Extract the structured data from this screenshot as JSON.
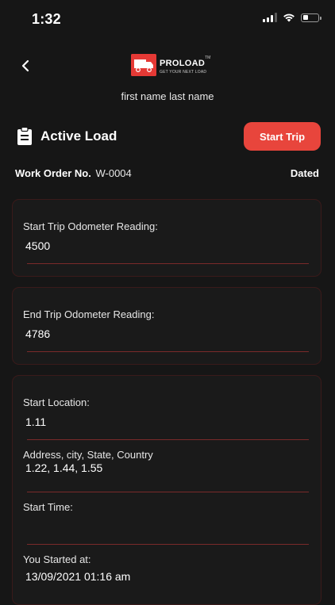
{
  "status": {
    "time": "1:32",
    "battery_level": 0.35
  },
  "header": {
    "logo_name": "PROLOAD",
    "logo_tm": "TM",
    "logo_tagline": "GET YOUR NEXT LOAD"
  },
  "driver": {
    "name": "first name last name"
  },
  "load": {
    "title": "Active Load",
    "start_trip_label": "Start Trip"
  },
  "work_order": {
    "label": "Work Order No.",
    "value": "W-0004",
    "dated_label": "Dated"
  },
  "odometer": {
    "start_label": "Start Trip Odometer Reading:",
    "start_value": "4500",
    "end_label": "End Trip Odometer Reading:",
    "end_value": "4786"
  },
  "trip": {
    "start_location_label": "Start Location:",
    "start_location_value": "1.11",
    "address_label": "Address, city, State, Country",
    "address_value": "1.22, 1.44, 1.55",
    "start_time_label": "Start Time:",
    "start_time_value": "",
    "started_at_label": "You Started at:",
    "started_at_value": "13/09/2021 01:16 am"
  },
  "colors": {
    "accent": "#e8453c",
    "background": "#161616",
    "divider": "#7a2a2a"
  }
}
